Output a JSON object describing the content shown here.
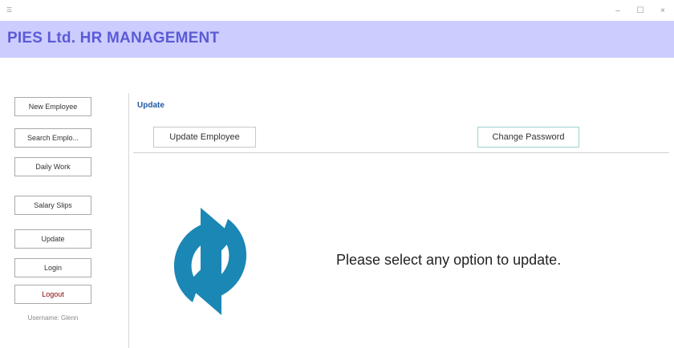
{
  "window": {
    "app_icon": "app-icon",
    "controls": {
      "minimize": "–",
      "maximize": "☐",
      "close": "×"
    }
  },
  "header": {
    "title": "PIES Ltd. HR MANAGEMENT"
  },
  "sidebar": {
    "items": [
      {
        "label": "New Employee"
      },
      {
        "label": "Search Emplo..."
      },
      {
        "label": "Daily Work"
      },
      {
        "label": "Salary Slips"
      },
      {
        "label": "Update"
      },
      {
        "label": "Login"
      },
      {
        "label": "Logout"
      }
    ],
    "username": "Username: Glenn"
  },
  "main": {
    "section_label": "Update",
    "tabs": [
      {
        "label": "Update Employee"
      },
      {
        "label": "Change Password"
      }
    ],
    "icon": "refresh-sync-icon",
    "message": "Please select any option to update."
  },
  "colors": {
    "header_bg": "#ccccff",
    "header_text": "#5b5bd6",
    "icon_blue": "#1b87b5",
    "section_label": "#1f5aa6",
    "logout_text": "#8b0000"
  }
}
